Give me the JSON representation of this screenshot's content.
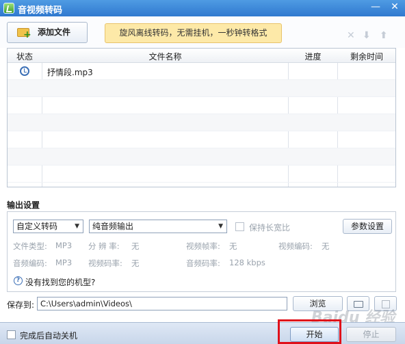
{
  "window": {
    "title": "音视频转码",
    "minimize": "—",
    "close": "✕"
  },
  "toolbar": {
    "add_file_label": "添加文件",
    "promo_text": "旋风离线转码，无需挂机，一秒钟转格式",
    "delete_icon": "✕",
    "down_icon": "⬇",
    "up_icon": "⬆"
  },
  "file_table": {
    "headers": {
      "status": "状态",
      "name": "文件名称",
      "progress": "进度",
      "remaining": "剩余时间"
    },
    "rows": [
      {
        "status_icon": "clock-icon",
        "name": "抒情段.mp3",
        "progress": "",
        "remaining": ""
      }
    ]
  },
  "output_settings": {
    "title": "输出设置",
    "profile_select": "自定义转码",
    "mode_select": "纯音频输出",
    "keep_ratio_label": "保持长宽比",
    "param_button": "参数设置",
    "file_type_label": "文件类型:",
    "file_type_value": "MP3",
    "resolution_label": "分 辨 率:",
    "resolution_value": "无",
    "video_fps_label": "视频帧率:",
    "video_fps_value": "无",
    "video_codec_label": "视频编码:",
    "video_codec_value": "无",
    "audio_codec_label": "音频编码:",
    "audio_codec_value": "MP3",
    "video_bitrate_label": "视频码率:",
    "video_bitrate_value": "无",
    "audio_bitrate_label": "音频码率:",
    "audio_bitrate_value": "128 kbps",
    "help_text": "没有找到您的机型?"
  },
  "save": {
    "label": "保存到:",
    "path": "C:\\Users\\admin\\Videos\\",
    "browse_button": "浏览"
  },
  "footer": {
    "shutdown_label": "完成后自动关机",
    "start_button": "开始",
    "stop_button": "停止"
  },
  "watermark": "Baidu 经验",
  "colors": {
    "highlight": "#e0101a",
    "title_bar": "#3a86d8",
    "promo_bg": "#fde9a8"
  }
}
